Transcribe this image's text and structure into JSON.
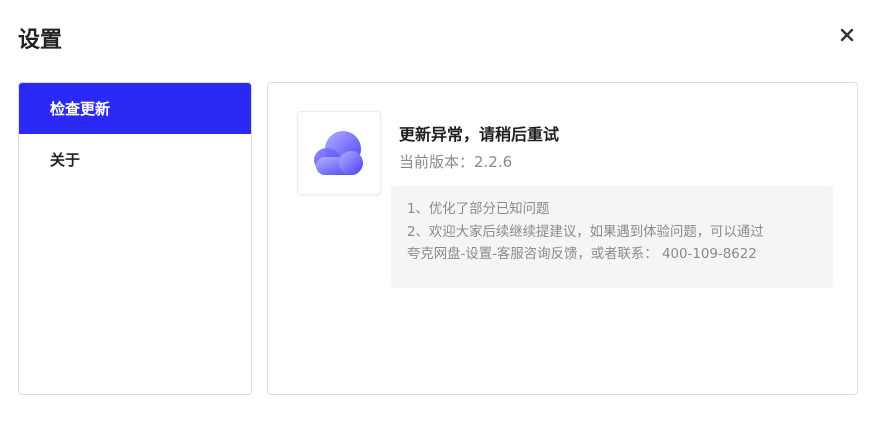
{
  "dialog": {
    "title": "设置",
    "close_icon": "close-icon"
  },
  "sidebar": {
    "items": [
      {
        "label": "检查更新",
        "active": true
      },
      {
        "label": "关于",
        "active": false
      }
    ]
  },
  "update": {
    "app_icon": "cloud-icon",
    "status": "更新异常，请稍后重试",
    "version": "当前版本：2.2.6",
    "notes": [
      "1、优化了部分已知问题",
      "2、欢迎大家后续继续提建议，如果遇到体验问题，可以通过",
      "夸克网盘-设置-客服咨询反馈，或者联系： 400-109-8622"
    ]
  },
  "colors": {
    "accent": "#2b29f5",
    "cloud_gradient_start": "#a8a6ff",
    "cloud_gradient_end": "#5b4bff"
  }
}
